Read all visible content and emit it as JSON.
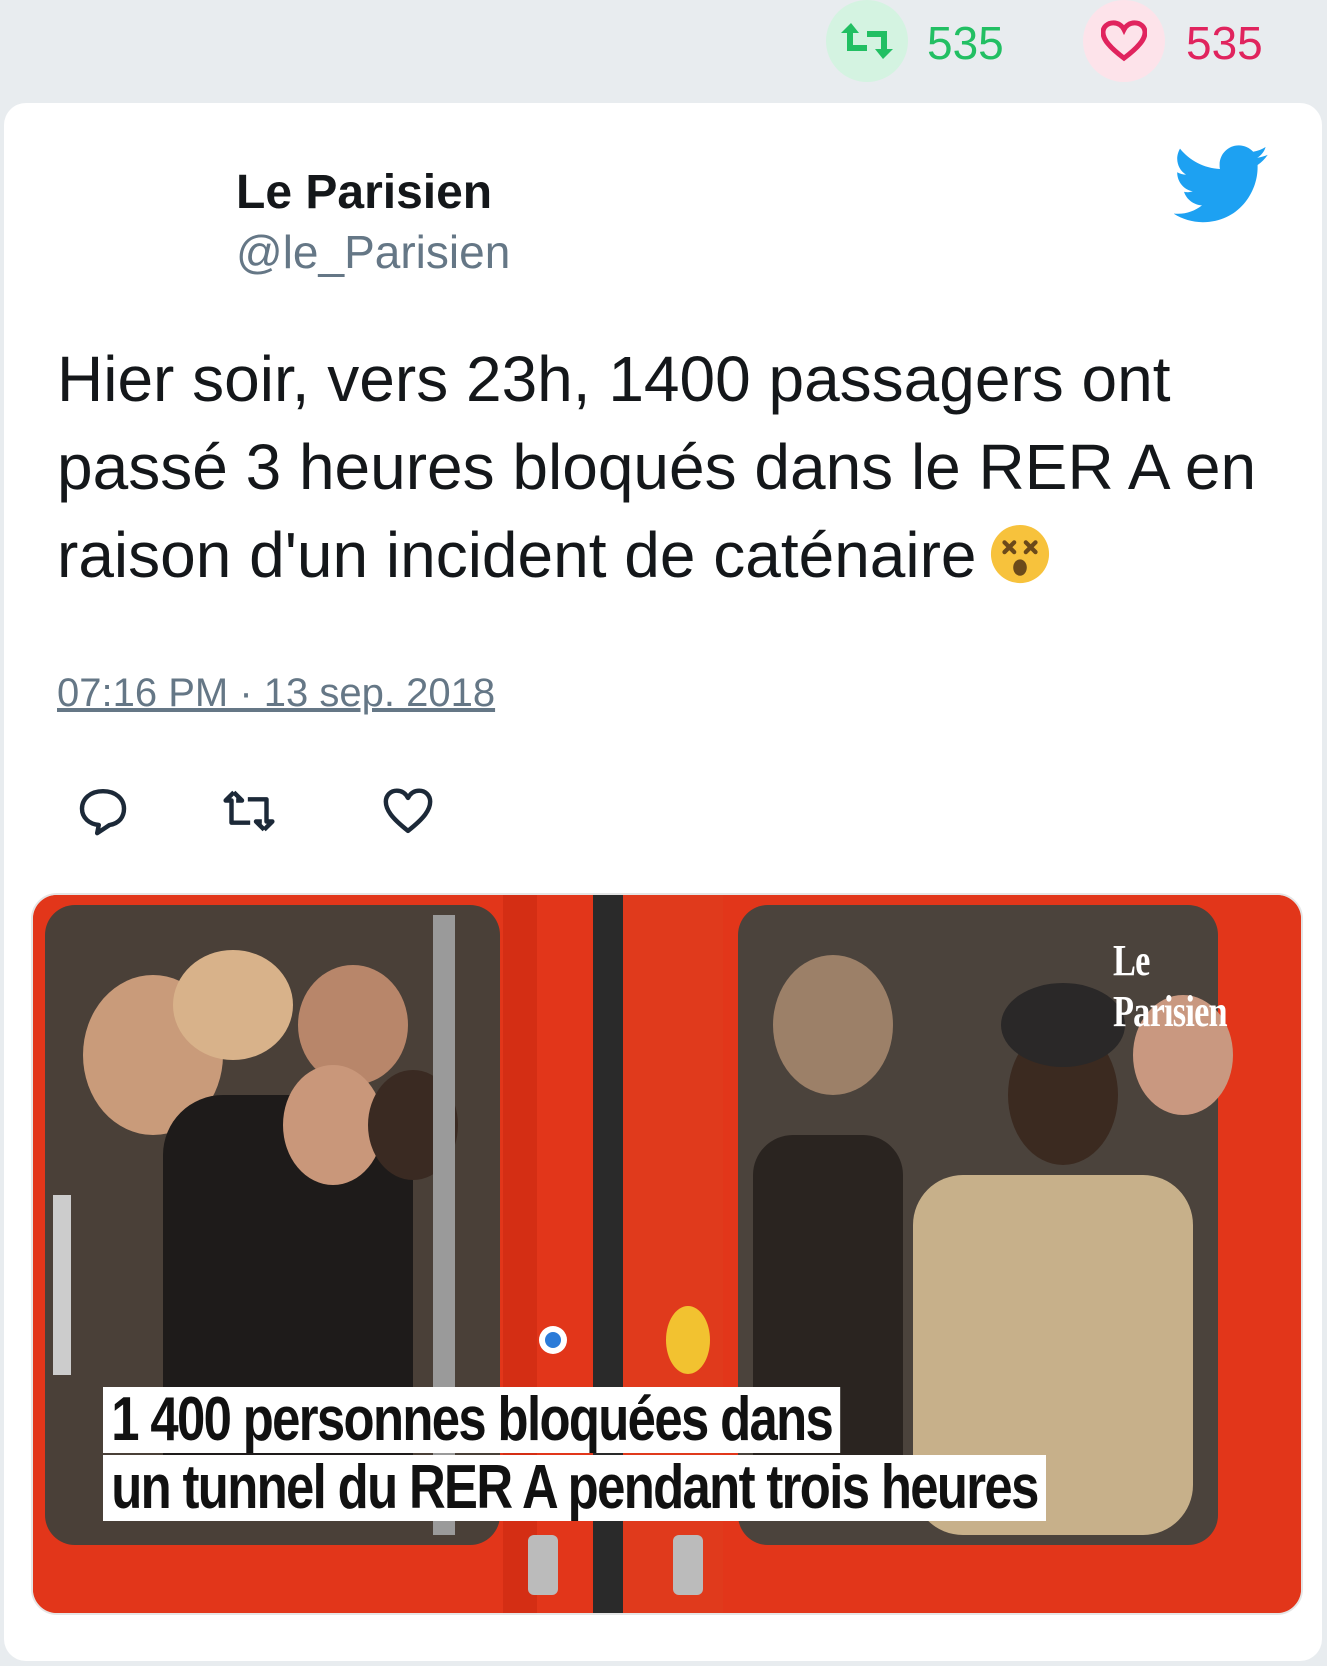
{
  "stats": {
    "retweets": "535",
    "likes": "535"
  },
  "tweet": {
    "author_name": "Le Parisien",
    "author_handle": "@le_Parisien",
    "text": "Hier soir, vers 23h, 1400 passagers ont passé 3 heures bloqués dans le RER A en raison d'un incident de caténaire",
    "timestamp": "07:16 PM · 13 sep. 2018"
  },
  "media": {
    "headline_line1": "1 400 personnes bloquées dans",
    "headline_line2": "un tunnel du RER A pendant trois heures",
    "watermark": "Le Parisien"
  },
  "colors": {
    "retweet_green": "#22bf63",
    "like_pink": "#e0245e",
    "twitter_blue": "#1da1f2",
    "train_red": "#e63b1c"
  },
  "icons": [
    "retweet-icon",
    "heart-icon",
    "twitter-bird-icon",
    "dizzy-face-emoji",
    "reply-icon"
  ]
}
